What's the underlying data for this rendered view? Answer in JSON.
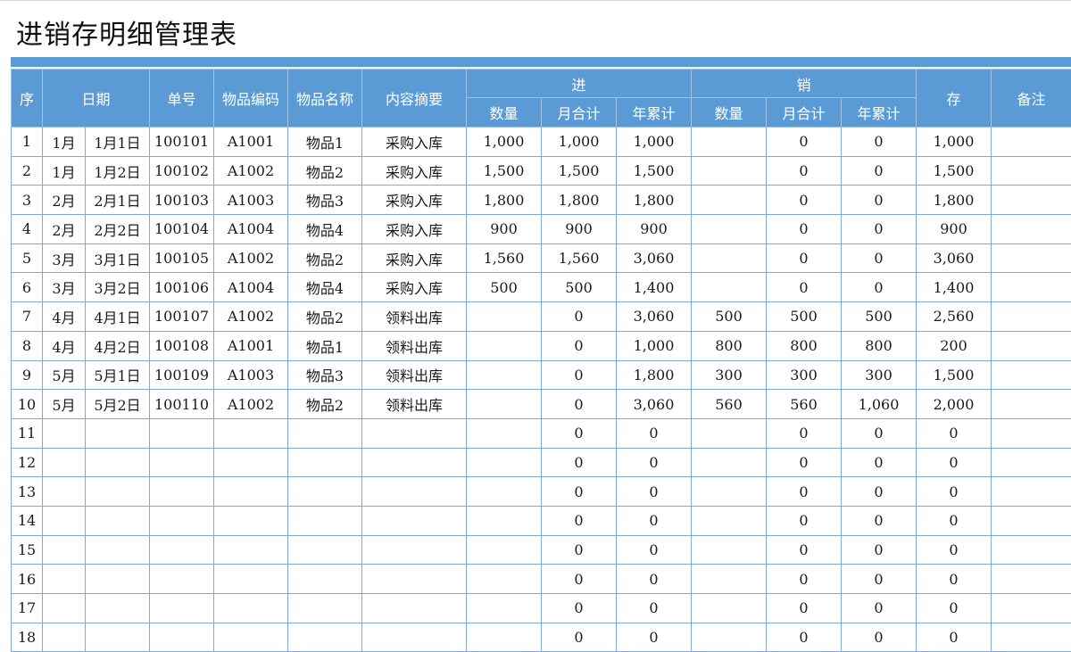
{
  "title": "进销存明细管理表",
  "header": {
    "seq": "序",
    "date": "日期",
    "doc_no": "单号",
    "item_code": "物品编码",
    "item_name": "物品名称",
    "summary": "内容摘要",
    "in_group": "进",
    "out_group": "销",
    "stock": "存",
    "remark": "备注",
    "in_sub": [
      "数量",
      "月合计",
      "年累计"
    ],
    "out_sub": [
      "数量",
      "月合计",
      "年累计"
    ]
  },
  "colors": {
    "header_bg": "#5b9bd5",
    "border": "#7fa9d8"
  },
  "rows": [
    [
      "1",
      "1月",
      "1月1日",
      "100101",
      "A1001",
      "物品1",
      "采购入库",
      "1,000",
      "1,000",
      "1,000",
      "",
      "0",
      "0",
      "1,000",
      ""
    ],
    [
      "2",
      "1月",
      "1月2日",
      "100102",
      "A1002",
      "物品2",
      "采购入库",
      "1,500",
      "1,500",
      "1,500",
      "",
      "0",
      "0",
      "1,500",
      ""
    ],
    [
      "3",
      "2月",
      "2月1日",
      "100103",
      "A1003",
      "物品3",
      "采购入库",
      "1,800",
      "1,800",
      "1,800",
      "",
      "0",
      "0",
      "1,800",
      ""
    ],
    [
      "4",
      "2月",
      "2月2日",
      "100104",
      "A1004",
      "物品4",
      "采购入库",
      "900",
      "900",
      "900",
      "",
      "0",
      "0",
      "900",
      ""
    ],
    [
      "5",
      "3月",
      "3月1日",
      "100105",
      "A1002",
      "物品2",
      "采购入库",
      "1,560",
      "1,560",
      "3,060",
      "",
      "0",
      "0",
      "3,060",
      ""
    ],
    [
      "6",
      "3月",
      "3月2日",
      "100106",
      "A1004",
      "物品4",
      "采购入库",
      "500",
      "500",
      "1,400",
      "",
      "0",
      "0",
      "1,400",
      ""
    ],
    [
      "7",
      "4月",
      "4月1日",
      "100107",
      "A1002",
      "物品2",
      "领料出库",
      "",
      "0",
      "3,060",
      "500",
      "500",
      "500",
      "2,560",
      ""
    ],
    [
      "8",
      "4月",
      "4月2日",
      "100108",
      "A1001",
      "物品1",
      "领料出库",
      "",
      "0",
      "1,000",
      "800",
      "800",
      "800",
      "200",
      ""
    ],
    [
      "9",
      "5月",
      "5月1日",
      "100109",
      "A1003",
      "物品3",
      "领料出库",
      "",
      "0",
      "1,800",
      "300",
      "300",
      "300",
      "1,500",
      ""
    ],
    [
      "10",
      "5月",
      "5月2日",
      "100110",
      "A1002",
      "物品2",
      "领料出库",
      "",
      "0",
      "3,060",
      "560",
      "560",
      "1,060",
      "2,000",
      ""
    ],
    [
      "11",
      "",
      "",
      "",
      "",
      "",
      "",
      "",
      "0",
      "0",
      "",
      "0",
      "0",
      "0",
      ""
    ],
    [
      "12",
      "",
      "",
      "",
      "",
      "",
      "",
      "",
      "0",
      "0",
      "",
      "0",
      "0",
      "0",
      ""
    ],
    [
      "13",
      "",
      "",
      "",
      "",
      "",
      "",
      "",
      "0",
      "0",
      "",
      "0",
      "0",
      "0",
      ""
    ],
    [
      "14",
      "",
      "",
      "",
      "",
      "",
      "",
      "",
      "0",
      "0",
      "",
      "0",
      "0",
      "0",
      ""
    ],
    [
      "15",
      "",
      "",
      "",
      "",
      "",
      "",
      "",
      "0",
      "0",
      "",
      "0",
      "0",
      "0",
      ""
    ],
    [
      "16",
      "",
      "",
      "",
      "",
      "",
      "",
      "",
      "0",
      "0",
      "",
      "0",
      "0",
      "0",
      ""
    ],
    [
      "17",
      "",
      "",
      "",
      "",
      "",
      "",
      "",
      "0",
      "0",
      "",
      "0",
      "0",
      "0",
      ""
    ],
    [
      "18",
      "",
      "",
      "",
      "",
      "",
      "",
      "",
      "0",
      "0",
      "",
      "0",
      "0",
      "0",
      ""
    ]
  ]
}
